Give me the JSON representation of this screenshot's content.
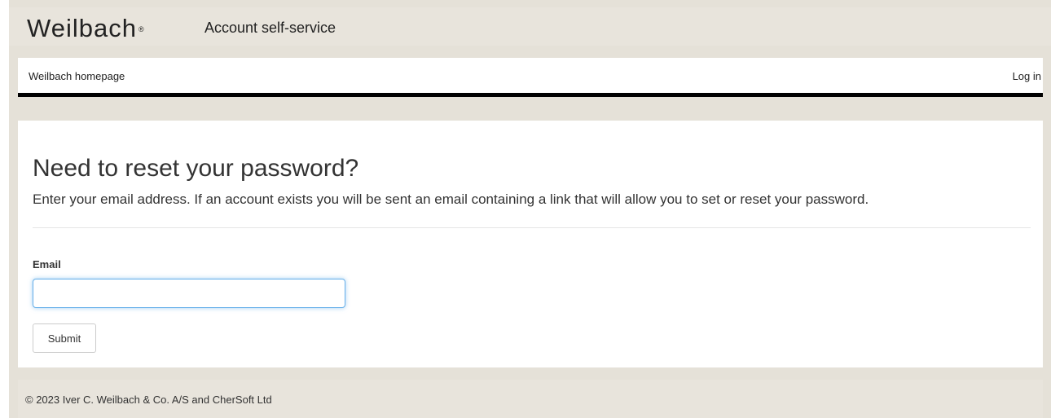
{
  "header": {
    "logo_text": "Weilbach",
    "logo_mark": "®",
    "site_title": "Account self-service"
  },
  "nav": {
    "home_link": "Weilbach homepage",
    "login_link": "Log in"
  },
  "main": {
    "title": "Need to reset your password?",
    "description": "Enter your email address. If an account exists you will be sent an email containing a link that will allow you to set or reset your password.",
    "email_label": "Email",
    "email_value": "",
    "submit_label": "Submit"
  },
  "footer": {
    "copyright": "© 2023 Iver C. Weilbach & Co. A/S and CherSoft Ltd"
  },
  "colors": {
    "page_background": "#e5e1d8",
    "nav_border": "#000000",
    "input_focus": "#66afe9"
  }
}
